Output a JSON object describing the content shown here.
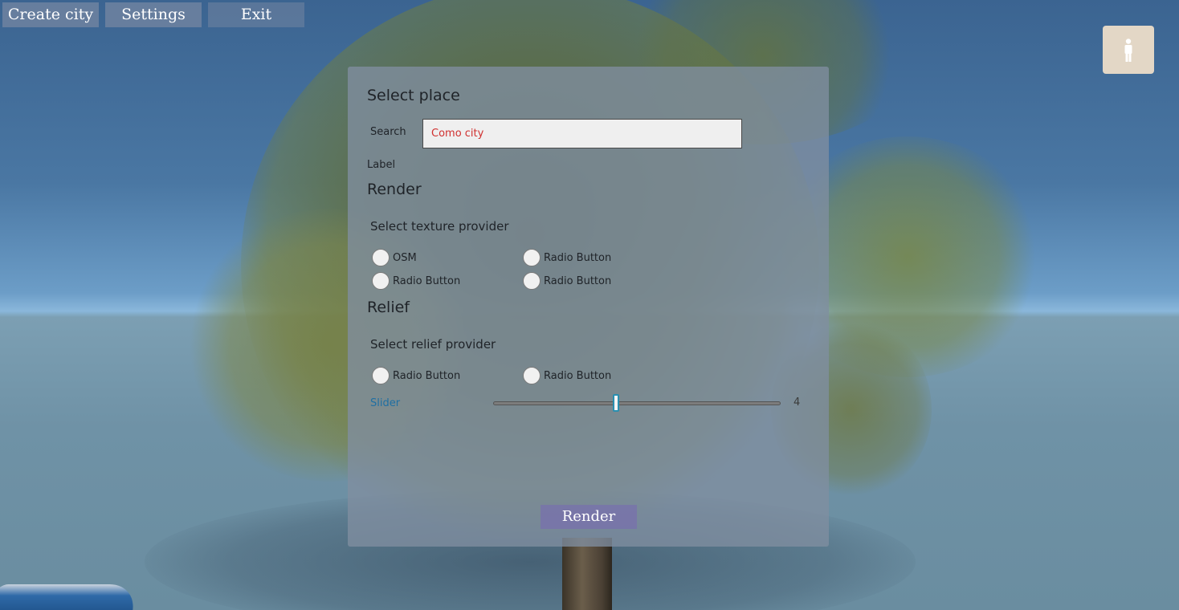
{
  "menu": {
    "create_city": "Create city",
    "settings": "Settings",
    "exit": "Exit"
  },
  "person_button": {
    "icon": "person-icon"
  },
  "panel": {
    "select_place_title": "Select place",
    "search_label": "Search",
    "search_value": "Como city",
    "label_text": "Label",
    "render_section": {
      "title": "Render",
      "subtitle": "Select texture provider",
      "options": [
        "OSM",
        "Radio Button",
        "Radio Button",
        "Radio Button"
      ]
    },
    "relief_section": {
      "title": "Relief",
      "subtitle": "Select relief provider",
      "options": [
        "Radio Button",
        "Radio Button"
      ]
    },
    "slider": {
      "label": "Slider",
      "value": "4"
    },
    "render_button": "Render"
  },
  "colors": {
    "menu_button": "#6e82a0",
    "panel": "#808ea0",
    "search_text": "#d0302f",
    "render_button": "#7873aa",
    "slider_label": "#1f6fa3",
    "person_button": "#e3d7c6"
  }
}
